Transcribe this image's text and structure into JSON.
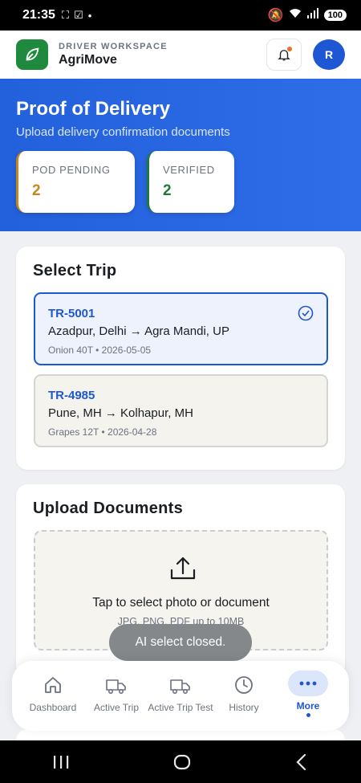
{
  "status_bar": {
    "time": "21:35",
    "battery": "100"
  },
  "app": {
    "workspace_label": "DRIVER WORKSPACE",
    "name": "AgriMove",
    "avatar_initial": "R"
  },
  "hero": {
    "title": "Proof of Delivery",
    "subtitle": "Upload delivery confirmation documents",
    "stats": [
      {
        "label": "POD PENDING",
        "value": "2",
        "color": "#c9861e"
      },
      {
        "label": "VERIFIED",
        "value": "2",
        "color": "#1f7a3a"
      }
    ]
  },
  "select_trip": {
    "title": "Select Trip",
    "trips": [
      {
        "id": "TR-5001",
        "route": "Azadpur, Delhi → Agra Mandi, UP",
        "meta": "Onion 40T • 2026-05-05",
        "selected": true
      },
      {
        "id": "TR-4985",
        "route": "Pune, MH → Kolhapur, MH",
        "meta": "Grapes 12T • 2026-04-28",
        "selected": false
      }
    ]
  },
  "upload": {
    "title": "Upload Documents",
    "prompt": "Tap to select photo or document",
    "hint": "JPG, PNG, PDF up to 10MB"
  },
  "toast": "AI select closed.",
  "bottom_nav": {
    "items": [
      {
        "label": "Dashboard",
        "icon": "home-icon"
      },
      {
        "label": "Active Trip",
        "icon": "truck-icon"
      },
      {
        "label": "Active Trip Test",
        "icon": "truck-icon"
      },
      {
        "label": "History",
        "icon": "clock-icon"
      },
      {
        "label": "More",
        "icon": "more-dots-icon",
        "active": true
      }
    ]
  },
  "colors": {
    "primary": "#1e57d3",
    "brand_green": "#1f8a3e",
    "pending": "#c9861e",
    "verified": "#1f7a3a"
  }
}
